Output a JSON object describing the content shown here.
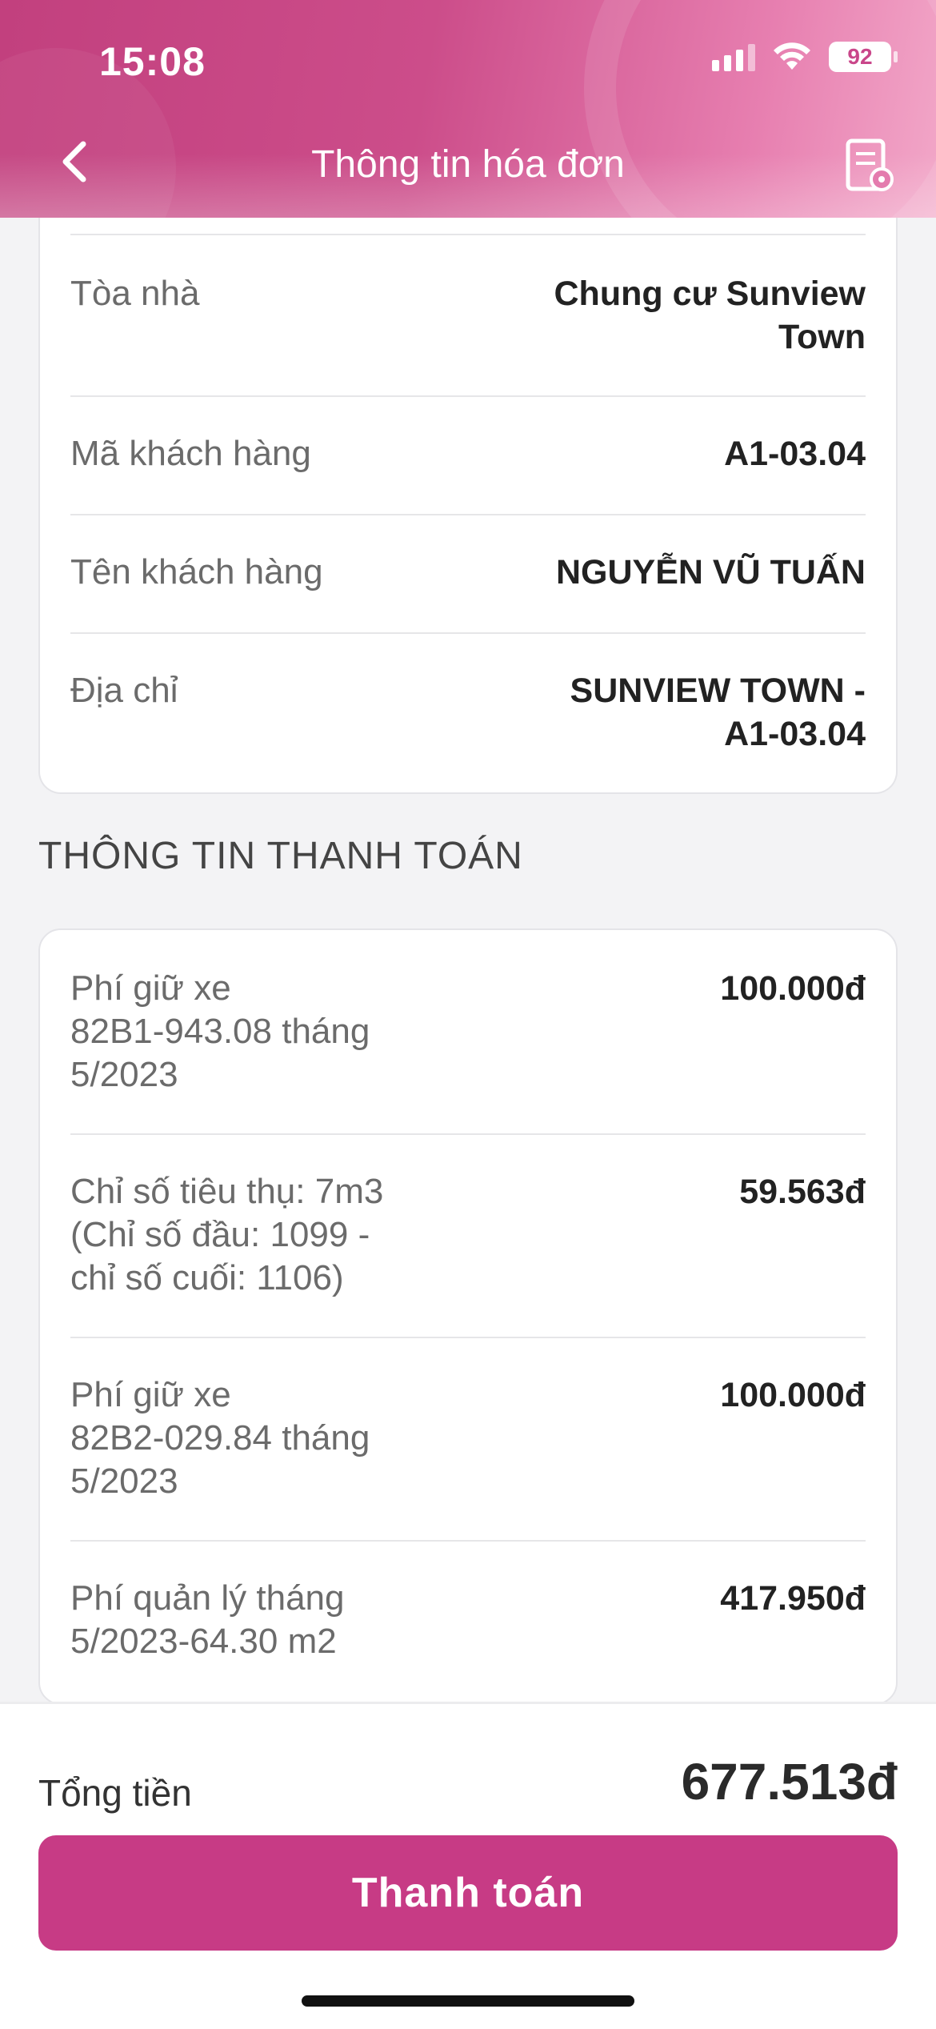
{
  "status_bar": {
    "time": "15:08",
    "battery": "92"
  },
  "header": {
    "title": "Thông tin hóa đơn"
  },
  "customer_info": [
    {
      "label": "Tòa nhà",
      "value_lines": [
        "Chung cư Sunview",
        "Town"
      ]
    },
    {
      "label": "Mã khách hàng",
      "value_lines": [
        "A1-03.04"
      ]
    },
    {
      "label": "Tên khách hàng",
      "value_lines": [
        "NGUYỄN VŨ TUẤN"
      ]
    },
    {
      "label": "Địa chỉ",
      "value_lines": [
        "SUNVIEW TOWN -",
        "A1-03.04"
      ]
    }
  ],
  "payment_section": {
    "title": "THÔNG TIN THANH TOÁN",
    "items": [
      {
        "label_lines": [
          "Phí giữ xe",
          "82B1-943.08 tháng",
          "5/2023"
        ],
        "amount": "100.000đ"
      },
      {
        "label_lines": [
          "Chỉ số tiêu thụ: 7m3",
          "(Chỉ số đầu: 1099 -",
          "chỉ số cuối: 1106)"
        ],
        "amount": "59.563đ"
      },
      {
        "label_lines": [
          "Phí giữ xe",
          "82B2-029.84 tháng",
          "5/2023"
        ],
        "amount": "100.000đ"
      },
      {
        "label_lines": [
          "Phí quản lý tháng",
          "5/2023-64.30 m2"
        ],
        "amount": "417.950đ"
      }
    ]
  },
  "footer": {
    "total_label": "Tổng tiền",
    "total_value": "677.513đ",
    "pay_button": "Thanh toán"
  },
  "colors": {
    "brand": "#c73b85",
    "header_gradient_start": "#c2407e",
    "header_gradient_end": "#f2a7c8"
  }
}
